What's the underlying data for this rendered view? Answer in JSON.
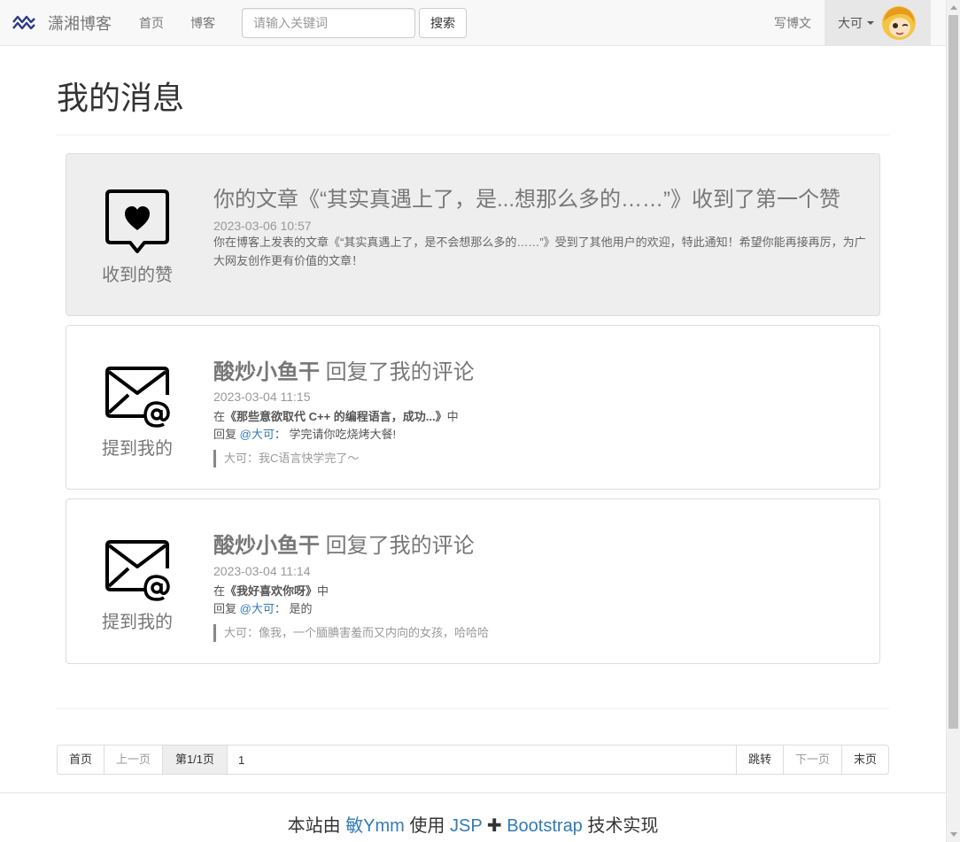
{
  "nav": {
    "brand": "潇湘博客",
    "links": [
      "首页",
      "博客"
    ],
    "search_placeholder": "请输入关键词",
    "search_button": "搜索",
    "write": "写博文",
    "user": "大可"
  },
  "page": {
    "title": "我的消息"
  },
  "messages": [
    {
      "icon_label": "收到的赞",
      "title": "你的文章《“其实真遇上了，是...想那么多的……”》收到了第一个赞",
      "date": "2023-03-06 10:57",
      "body": "你在博客上发表的文章《“其实真遇上了，是不会想那么多的……”》受到了其他用户的欢迎，特此通知！希望你能再接再厉，为广大网友创作更有价值的文章！"
    },
    {
      "icon_label": "提到我的",
      "author": "酸炒小鱼干",
      "action": " 回复了我的评论",
      "date": "2023-03-04 11:15",
      "in_prefix": "在",
      "article": "《那些意欲取代 C++ 的编程语言，成功...》",
      "in_suffix": "中",
      "reply_prefix": "回复",
      "mention": "@大可",
      "reply_sep": "：",
      "reply": "学完请你吃烧烤大餐!",
      "quote": "大可：我C语言快学完了～"
    },
    {
      "icon_label": "提到我的",
      "author": "酸炒小鱼干",
      "action": " 回复了我的评论",
      "date": "2023-03-04 11:14",
      "in_prefix": "在",
      "article": "《我好喜欢你呀》",
      "in_suffix": "中",
      "reply_prefix": "回复",
      "mention": "@大可",
      "reply_sep": "：",
      "reply": "是的",
      "quote": "大可：像我，一个腼腆害羞而又内向的女孩，哈哈哈"
    }
  ],
  "pagination": {
    "first": "首页",
    "prev": "上一页",
    "current": "第1/1页",
    "input_value": "1",
    "jump": "跳转",
    "next": "下一页",
    "last": "末页"
  },
  "footer": {
    "prefix": "本站由",
    "author": "敏Ymm",
    "mid": "使用",
    "tech1": "JSP",
    "plus": "✚",
    "tech2": "Bootstrap",
    "suffix": "技术实现"
  },
  "colors": {
    "link": "#337ab7",
    "active_card": "#eeeeee",
    "navbar": "#f8f8f8"
  }
}
